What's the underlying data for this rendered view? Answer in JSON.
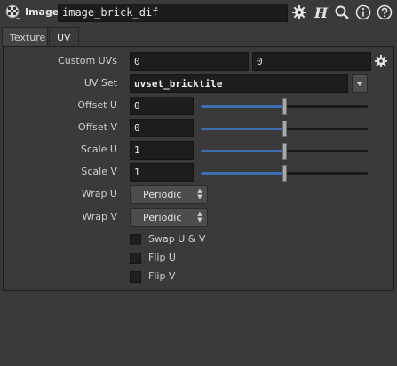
{
  "header": {
    "node_type": "Image",
    "node_name": "image_brick_dif",
    "icons": [
      "checker-icon",
      "gear-icon",
      "houdini-h-icon",
      "search-icon",
      "info-icon",
      "help-icon"
    ]
  },
  "tabs": [
    {
      "label": "Texture",
      "active": false
    },
    {
      "label": "UV",
      "active": true
    }
  ],
  "params": {
    "custom_uvs": {
      "label": "Custom UVs",
      "value1": "0",
      "value2": "0"
    },
    "uv_set": {
      "label": "UV Set",
      "value": "uvset_bricktile"
    },
    "offset_u": {
      "label": "Offset U",
      "value": "0",
      "slider": 0.5
    },
    "offset_v": {
      "label": "Offset V",
      "value": "0",
      "slider": 0.5
    },
    "scale_u": {
      "label": "Scale U",
      "value": "1",
      "slider": 0.5
    },
    "scale_v": {
      "label": "Scale V",
      "value": "1",
      "slider": 0.5
    },
    "wrap_u": {
      "label": "Wrap U",
      "value": "Periodic"
    },
    "wrap_v": {
      "label": "Wrap V",
      "value": "Periodic"
    },
    "swap_uv": {
      "label": "Swap U & V",
      "checked": false
    },
    "flip_u": {
      "label": "Flip U",
      "checked": false
    },
    "flip_v": {
      "label": "Flip V",
      "checked": false
    }
  },
  "colors": {
    "background": "#3a3a3a",
    "field": "#1d1d1d",
    "slider_fill": "#3d6fb0"
  }
}
